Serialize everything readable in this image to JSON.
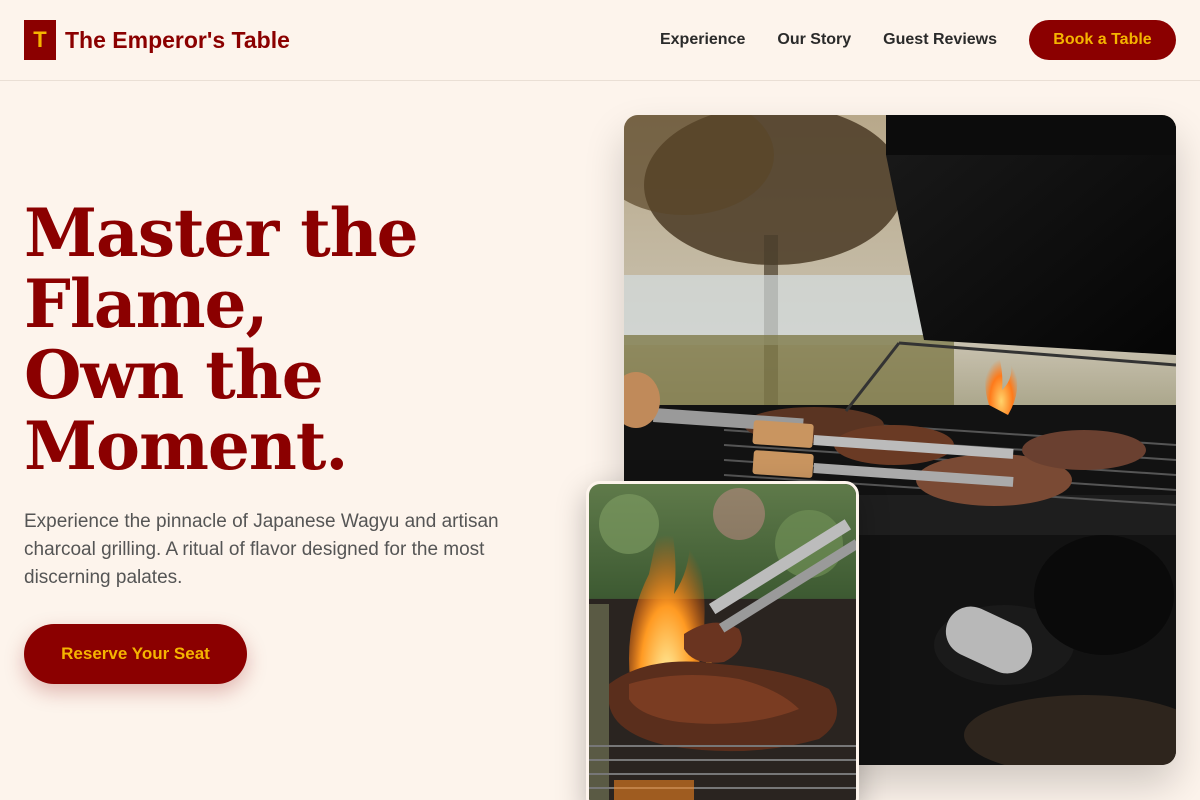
{
  "header": {
    "logo_letter": "T",
    "brand_name": "The Emperor's Table",
    "nav": [
      "Experience",
      "Our Story",
      "Guest Reviews"
    ],
    "book_label": "Book a Table"
  },
  "hero": {
    "title_lines": [
      "Master the",
      "Flame,",
      "Own the",
      "Moment."
    ],
    "description": "Experience the pinnacle of Japanese Wagyu and artisan charcoal grilling. A ritual of flavor designed for the most discerning palates.",
    "cta_label": "Reserve Your Seat"
  },
  "images": {
    "main": "grill-with-steaks-photo",
    "inset": "flaming-steak-photo"
  },
  "colors": {
    "background": "#fdf4ec",
    "brand": "#8b0000",
    "accent": "#f5b400",
    "text": "#2a2a2a",
    "muted": "#555555"
  }
}
